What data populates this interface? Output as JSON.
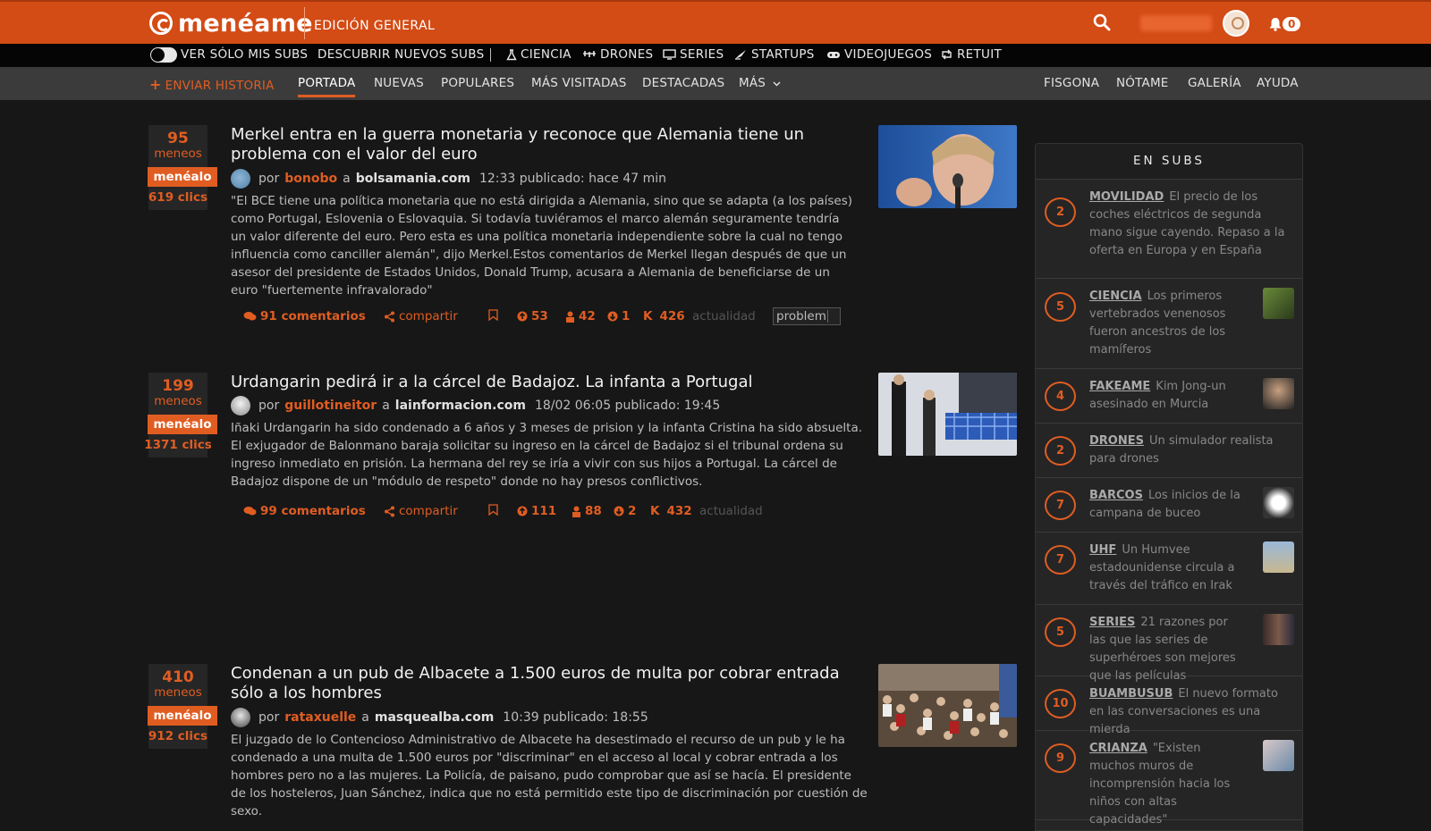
{
  "header": {
    "logo_text": "menéame",
    "edition": "EDICIÓN GENERAL",
    "notification_count": "0",
    "colors": {
      "brand": "#d34b15",
      "accent": "#e05d22"
    }
  },
  "subs_bar": {
    "toggle_label": "VER SÓLO MIS SUBS",
    "discover_label": "DESCUBRIR NUEVOS SUBS",
    "items": [
      {
        "label": "CIENCIA",
        "icon": "flask-icon"
      },
      {
        "label": "DRONES",
        "icon": "drone-icon"
      },
      {
        "label": "SERIES",
        "icon": "monitor-icon"
      },
      {
        "label": "STARTUPS",
        "icon": "rocket-icon"
      },
      {
        "label": "VIDEOJUEGOS",
        "icon": "gamepad-icon"
      },
      {
        "label": "RETUIT",
        "icon": "retweet-icon"
      }
    ]
  },
  "nav": {
    "send_story": "ENVIAR HISTORIA",
    "tabs": [
      "PORTADA",
      "NUEVAS",
      "POPULARES",
      "MÁS VISITADAS",
      "DESTACADAS",
      "MÁS"
    ],
    "active_tab": "PORTADA",
    "right_links": [
      "FISGONA",
      "NÓTAME",
      "GALERÍA",
      "AYUDA"
    ]
  },
  "stories": [
    {
      "votes": "95",
      "votes_label": "meneos",
      "button": "menéalo",
      "clicks": "619 clics",
      "title": "Merkel entra en la guerra monetaria y reconoce que Alemania tiene un problema con el valor del euro",
      "by": "por",
      "author": "bonobo",
      "at": "a",
      "site": "bolsamania.com",
      "time": "12:33 publicado: hace 47 min",
      "body": "\"El BCE tiene una política monetaria que no está dirigida a Alemania, sino que se adapta (a los países) como Portugal, Eslovenia o Eslovaquia. Si todavía tuviéramos el marco alemán seguramente tendría un valor diferente del euro. Pero esta es una política monetaria independiente sobre la cual no tengo influencia como canciller alemán\", dijo Merkel.Estos comentarios de Merkel llegan después de que un asesor del presidente de Estados Unidos, Donald Trump, acusara a Alemania de beneficiarse de un euro \"fuertemente infravalorado\"",
      "comments": "91 comentarios",
      "share": "compartir",
      "positive": "53",
      "anonymous": "42",
      "negative": "1",
      "karma_label": "K",
      "karma": "426",
      "category": "actualidad",
      "tag": "problem"
    },
    {
      "votes": "199",
      "votes_label": "meneos",
      "button": "menéalo",
      "clicks": "1371 clics",
      "title": "Urdangarin pedirá ir a la cárcel de Badajoz. La infanta a Portugal",
      "by": "por",
      "author": "guillotineitor",
      "at": "a",
      "site": "lainformacion.com",
      "time": "18/02 06:05 publicado: 19:45",
      "body": "Iñaki Urdangarin ha sido condenado a 6 años y 3 meses de prision y la infanta Cristina ha sido absuelta. El exjugador de Balonmano baraja solicitar su ingreso en la cárcel de Badajoz si el tribunal ordena su ingreso inmediato en prisión. La hermana del rey se iría a vivir con sus hijos a Portugal. La cárcel de Badajoz dispone de un \"módulo de respeto\" donde no hay presos conflictivos.",
      "comments": "99 comentarios",
      "share": "compartir",
      "positive": "111",
      "anonymous": "88",
      "negative": "2",
      "karma_label": "K",
      "karma": "432",
      "category": "actualidad"
    },
    {
      "votes": "410",
      "votes_label": "meneos",
      "button": "menéalo",
      "clicks": "912 clics",
      "title": "Condenan a un pub de Albacete a 1.500 euros de multa por cobrar entrada sólo a los hombres",
      "by": "por",
      "author": "rataxuelle",
      "at": "a",
      "site": "masquealba.com",
      "time": "10:39 publicado: 18:55",
      "body": "El juzgado de lo Contencioso Administrativo de Albacete ha desestimado el recurso de un pub y le ha condenado a una multa de 1.500 euros por \"discriminar\" en el acceso al local y cobrar entrada a los hombres pero no a las mujeres. La Policía, de paisano, pudo comprobar que así se hacía. El presidente de los hosteleros, Juan Sánchez, indica que no está permitido este tipo de discriminación por cuestión de sexo."
    }
  ],
  "sidebar": {
    "title": "EN SUBS",
    "items": [
      {
        "count": "2",
        "sub": "MOVILIDAD",
        "text": "El precio de los coches eléctricos de segunda mano sigue cayendo. Repaso a la oferta en Europa y en España"
      },
      {
        "count": "5",
        "sub": "CIENCIA",
        "text": "Los primeros vertebrados venenosos fueron ancestros de los mamíferos"
      },
      {
        "count": "4",
        "sub": "FAKEAME",
        "text": "Kim Jong-un asesinado en Murcia"
      },
      {
        "count": "2",
        "sub": "DRONES",
        "text": "Un simulador realista para drones"
      },
      {
        "count": "7",
        "sub": "BARCOS",
        "text": "Los inicios de la campana de buceo"
      },
      {
        "count": "7",
        "sub": "UHF",
        "text": "Un Humvee estadounidense circula a través del tráfico en Irak"
      },
      {
        "count": "5",
        "sub": "SERIES",
        "text": "21 razones por las que las series de superhéroes son mejores que las películas"
      },
      {
        "count": "10",
        "sub": "BUAMBUSUB",
        "text": "El nuevo formato en las conversaciones es una mierda"
      },
      {
        "count": "9",
        "sub": "CRIANZA",
        "text": "\"Existen muchos muros de incomprensión hacia los niños con altas capacidades\""
      }
    ]
  }
}
